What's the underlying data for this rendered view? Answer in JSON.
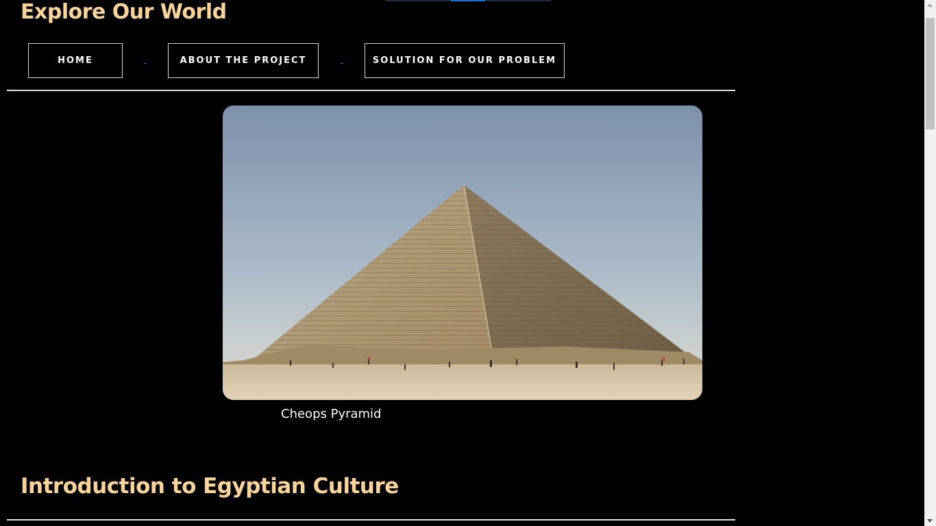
{
  "site": {
    "title": "Explore Our World"
  },
  "nav": {
    "items": [
      {
        "label": "HOME"
      },
      {
        "label": "ABOUT THE PROJECT"
      },
      {
        "label": "SOLUTION FOR OUR PROBLEM"
      }
    ]
  },
  "hero": {
    "image_alt": "Cheops Pyramid",
    "caption": "Cheops Pyramid"
  },
  "section": {
    "title": "Introduction to Egyptian Culture"
  },
  "colors": {
    "background": "#000000",
    "heading": "#f8d39a",
    "nav_border": "#d9d9d9",
    "text": "#ffffff"
  }
}
